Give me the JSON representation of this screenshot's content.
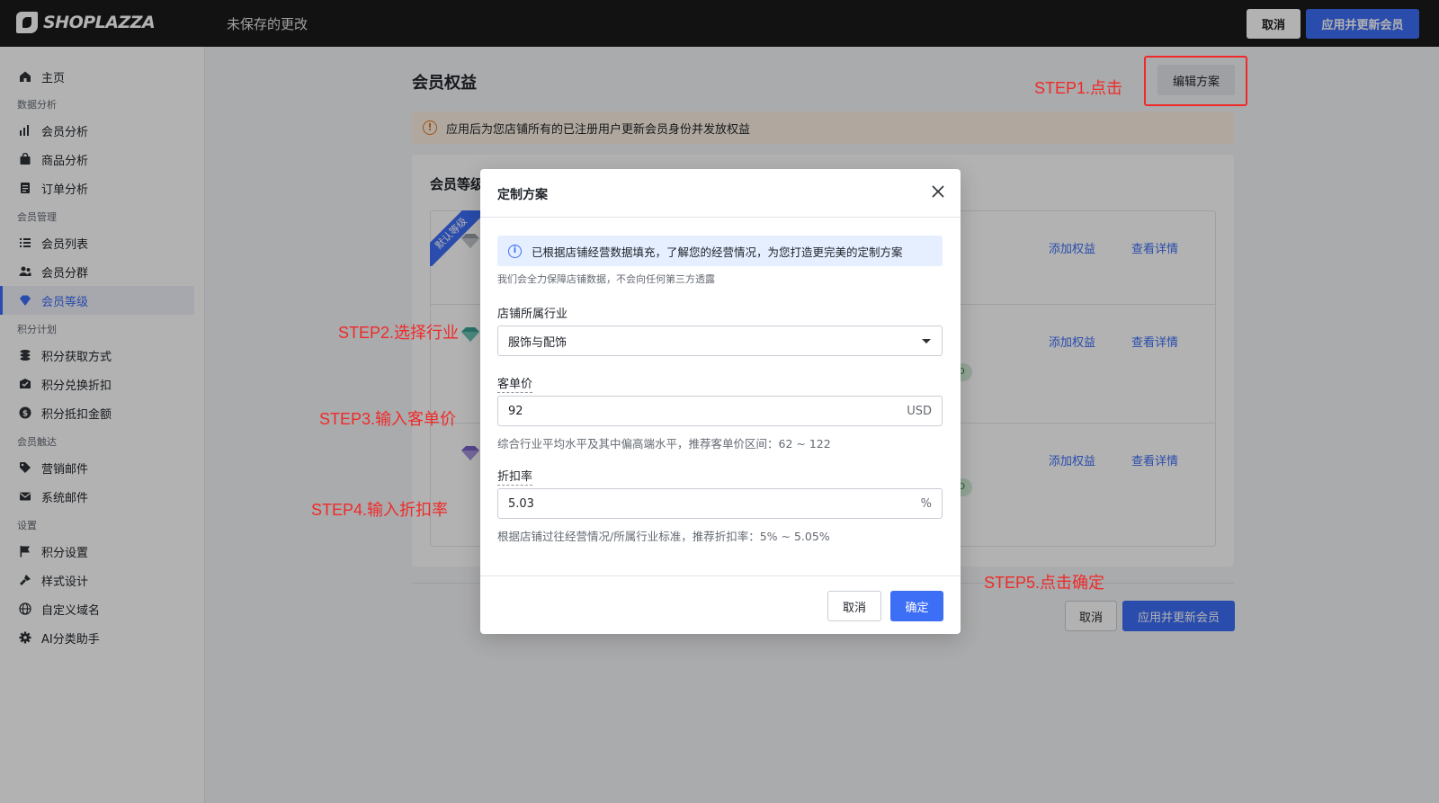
{
  "topbar": {
    "logo": "SHOPLAZZA",
    "title": "未保存的更改",
    "cancel": "取消",
    "apply": "应用并更新会员"
  },
  "sidebar": {
    "items": [
      {
        "label": "主页",
        "icon": "home-icon"
      },
      {
        "section": "数据分析"
      },
      {
        "label": "会员分析",
        "icon": "bar-chart-icon"
      },
      {
        "label": "商品分析",
        "icon": "bag-icon"
      },
      {
        "label": "订单分析",
        "icon": "document-icon"
      },
      {
        "section": "会员管理"
      },
      {
        "label": "会员列表",
        "icon": "list-icon"
      },
      {
        "label": "会员分群",
        "icon": "users-icon"
      },
      {
        "label": "会员等级",
        "icon": "diamond-icon",
        "active": true
      },
      {
        "section": "积分计划"
      },
      {
        "label": "积分获取方式",
        "icon": "coins-icon"
      },
      {
        "label": "积分兑换折扣",
        "icon": "ticket-icon"
      },
      {
        "label": "积分抵扣金额",
        "icon": "dollar-icon"
      },
      {
        "section": "会员触达"
      },
      {
        "label": "营销邮件",
        "icon": "tag-icon"
      },
      {
        "label": "系统邮件",
        "icon": "mail-icon"
      },
      {
        "section": "设置"
      },
      {
        "label": "积分设置",
        "icon": "flag-icon"
      },
      {
        "label": "样式设计",
        "icon": "brush-icon"
      },
      {
        "label": "自定义域名",
        "icon": "globe-icon"
      },
      {
        "label": "AI分类助手",
        "icon": "gear-icon"
      }
    ]
  },
  "main": {
    "title": "会员权益",
    "edit_plan": "编辑方案",
    "warning": "应用后为您店铺所有的已注册用户更新会员身份并发放权益",
    "card_title": "会员等级",
    "default_ribbon": "默认等级",
    "add_benefit": "添加权益",
    "view_detail": "查看详情",
    "pill_1": "D",
    "pill_2": "SD",
    "cancel": "取消",
    "apply": "应用并更新会员"
  },
  "modal": {
    "title": "定制方案",
    "info": "已根据店铺经营数据填充，了解您的经营情况，为您打造更完美的定制方案",
    "info_sub": "我们会全力保障店铺数据，不会向任何第三方透露",
    "industry_label": "店铺所属行业",
    "industry_value": "服饰与配饰",
    "aov_label": "客单价",
    "aov_value": "92",
    "aov_unit": "USD",
    "aov_hint": "综合行业平均水平及其中偏高端水平，推荐客单价区间：62 ~ 122",
    "discount_label": "折扣率",
    "discount_value": "5.03",
    "discount_unit": "%",
    "discount_hint": "根据店铺过往经营情况/所属行业标准，推荐折扣率：5% ~ 5.05%",
    "cancel": "取消",
    "ok": "确定"
  },
  "steps": {
    "s1": "STEP1.点击",
    "s2": "STEP2.选择行业",
    "s3": "STEP3.输入客单价",
    "s4": "STEP4.输入折扣率",
    "s5": "STEP5.点击确定"
  },
  "colors": {
    "primary": "#3d6ef6",
    "annotation": "#f02a2a",
    "warning": "#e37318"
  }
}
